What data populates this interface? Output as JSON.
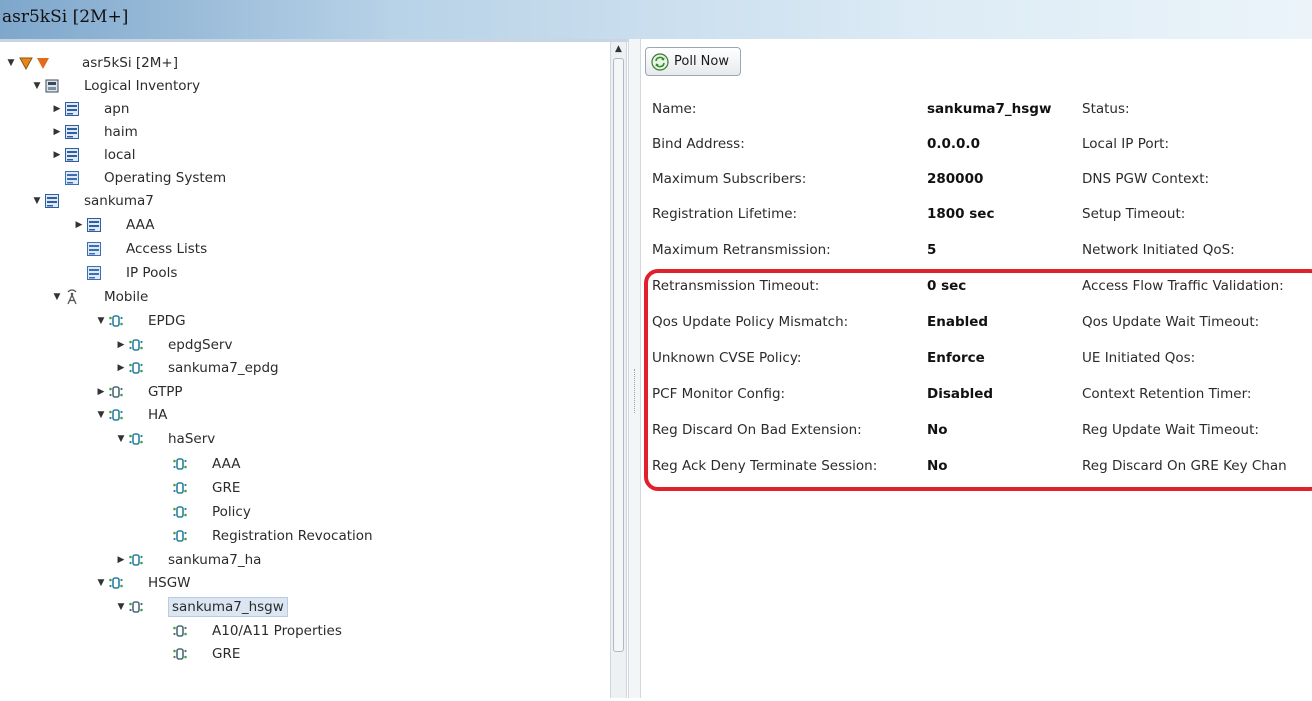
{
  "window": {
    "title": "asr5kSi [2M+]"
  },
  "tree": {
    "items": [
      {
        "label": "asr5kSi [2M+]",
        "icon": "device-icon"
      },
      {
        "label": "Logical Inventory",
        "icon": "inventory-icon"
      },
      {
        "label": "apn",
        "icon": "context-icon"
      },
      {
        "label": "haim",
        "icon": "context-icon"
      },
      {
        "label": "local",
        "icon": "context-icon"
      },
      {
        "label": "Operating System",
        "icon": "os-icon"
      },
      {
        "label": "sankuma7",
        "icon": "context-icon"
      },
      {
        "label": "AAA",
        "icon": "aaa-icon"
      },
      {
        "label": "Access Lists",
        "icon": "list-icon"
      },
      {
        "label": "IP Pools",
        "icon": "list-icon"
      },
      {
        "label": "Mobile",
        "icon": "antenna-icon"
      },
      {
        "label": "EPDG",
        "icon": "service-icon"
      },
      {
        "label": "epdgServ",
        "icon": "service-icon"
      },
      {
        "label": "sankuma7_epdg",
        "icon": "service-icon"
      },
      {
        "label": "GTPP",
        "icon": "gear-service-icon"
      },
      {
        "label": "HA",
        "icon": "service-icon"
      },
      {
        "label": "haServ",
        "icon": "service-icon"
      },
      {
        "label": "AAA",
        "icon": "service-icon"
      },
      {
        "label": "GRE",
        "icon": "service-icon"
      },
      {
        "label": "Policy",
        "icon": "service-icon"
      },
      {
        "label": "Registration Revocation",
        "icon": "service-icon"
      },
      {
        "label": "sankuma7_ha",
        "icon": "service-icon"
      },
      {
        "label": "HSGW",
        "icon": "service-icon"
      },
      {
        "label": "sankuma7_hsgw",
        "icon": "gear-service-icon"
      },
      {
        "label": "A10/A11 Properties",
        "icon": "gear-service-icon"
      },
      {
        "label": "GRE",
        "icon": "gear-service-icon"
      }
    ]
  },
  "toolbar": {
    "poll_now_label": "Poll Now",
    "poll_icon": "refresh-icon"
  },
  "properties": {
    "left": [
      {
        "label": "Name:",
        "value": "sankuma7_hsgw"
      },
      {
        "label": "Bind Address:",
        "value": "0.0.0.0"
      },
      {
        "label": "Maximum Subscribers:",
        "value": "280000"
      },
      {
        "label": "Registration Lifetime:",
        "value": "1800 sec"
      },
      {
        "label": "Maximum Retransmission:",
        "value": "5"
      },
      {
        "label": "Retransmission Timeout:",
        "value": "0 sec"
      },
      {
        "label": "Qos Update Policy Mismatch:",
        "value": "Enabled"
      },
      {
        "label": "Unknown CVSE Policy:",
        "value": "Enforce"
      },
      {
        "label": "PCF Monitor Config:",
        "value": "Disabled"
      },
      {
        "label": "Reg Discard On Bad Extension:",
        "value": "No"
      },
      {
        "label": "Reg Ack Deny Terminate Session:",
        "value": "No"
      }
    ],
    "right": [
      {
        "label": "Status:"
      },
      {
        "label": "Local IP Port:"
      },
      {
        "label": "DNS PGW Context:"
      },
      {
        "label": "Setup Timeout:"
      },
      {
        "label": "Network Initiated QoS:"
      },
      {
        "label": "Access Flow Traffic Validation:"
      },
      {
        "label": "Qos Update Wait Timeout:"
      },
      {
        "label": "UE Initiated Qos:"
      },
      {
        "label": "Context Retention Timer:"
      },
      {
        "label": "Reg Update Wait Timeout:"
      },
      {
        "label": "Reg Discard On GRE Key Chan"
      }
    ]
  },
  "colors": {
    "highlight": "#e0202a",
    "title_bar": "#b8d2e7",
    "selection": "#dbe6f2"
  }
}
